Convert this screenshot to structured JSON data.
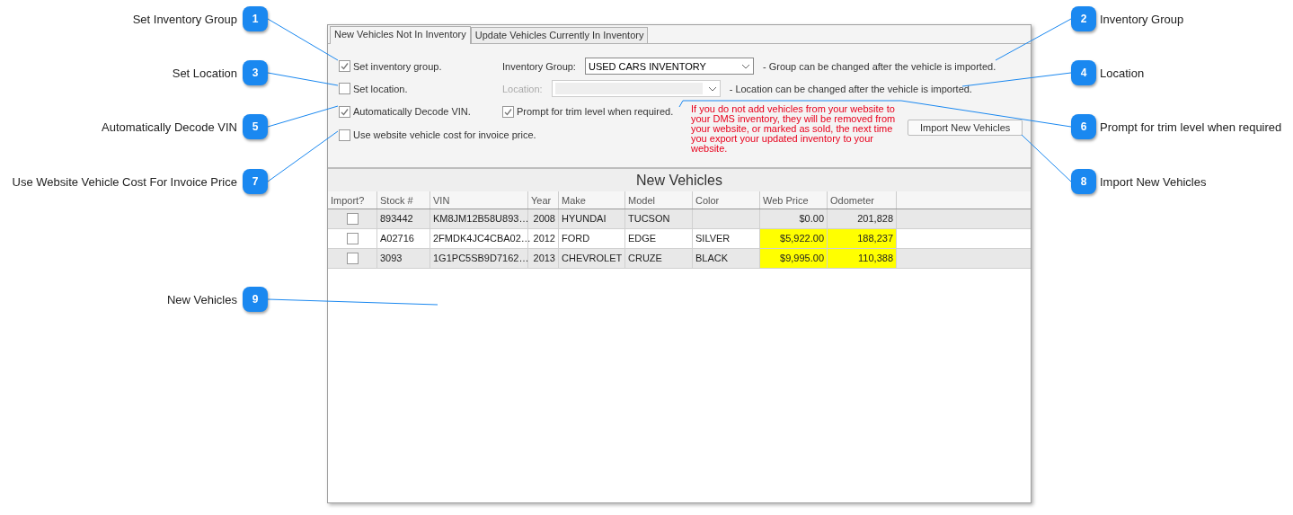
{
  "callouts": [
    {
      "number": "1",
      "label": "Set Inventory Group"
    },
    {
      "number": "2",
      "label": "Inventory Group"
    },
    {
      "number": "3",
      "label": "Set Location"
    },
    {
      "number": "4",
      "label": "Location"
    },
    {
      "number": "5",
      "label": "Automatically Decode VIN"
    },
    {
      "number": "6",
      "label": "Prompt for trim level when required"
    },
    {
      "number": "7",
      "label": "Use Website Vehicle Cost For Invoice Price"
    },
    {
      "number": "8",
      "label": "Import New Vehicles"
    },
    {
      "number": "9",
      "label": "New Vehicles"
    }
  ],
  "tabs": [
    {
      "label": "New Vehicles Not In Inventory",
      "selected": true
    },
    {
      "label": "Update Vehicles Currently In Inventory",
      "selected": false
    }
  ],
  "options": [
    {
      "label": "Set inventory group.",
      "checked": true
    },
    {
      "label": "Set location.",
      "checked": false
    },
    {
      "label": "Automatically Decode VIN.",
      "checked": true
    },
    {
      "label": "Use website vehicle cost for invoice price.",
      "checked": false
    }
  ],
  "group_field": {
    "label": "Inventory Group:",
    "value": "USED CARS INVENTORY",
    "disabled": false,
    "note": "- Group can be changed after the vehicle is imported."
  },
  "location_field": {
    "label": "Location:",
    "disabled": true,
    "note": "- Location can be changed after the vehicle is imported."
  },
  "trim_prompt": {
    "label": "Prompt for trim level when required.",
    "checked": true
  },
  "warning": "If you do not add vehicles from your website to your DMS inventory, they will be removed from your website, or marked as sold, the next time you export your updated inventory to your website.",
  "import_button": "Import New Vehicles",
  "grid": {
    "title": "New Vehicles",
    "import_header": "Import?",
    "columns": [
      "Stock #",
      "VIN",
      "Year",
      "Make",
      "Model",
      "Color",
      "Web Price",
      "Odometer"
    ],
    "rows": [
      {
        "import": false,
        "highlighted": false,
        "cells": [
          "893442",
          "KM8JM12B58U893…",
          "2008",
          "HYUNDAI",
          "TUCSON",
          "",
          "$0.00",
          "201,828"
        ]
      },
      {
        "import": false,
        "highlighted": true,
        "cells": [
          "A02716",
          "2FMDK4JC4CBA02…",
          "2012",
          "FORD",
          "EDGE",
          "SILVER",
          "$5,922.00",
          "188,237"
        ]
      },
      {
        "import": false,
        "highlighted": true,
        "cells": [
          "3093",
          "1G1PC5SB9D7162…",
          "2013",
          "CHEVROLET",
          "CRUZE",
          "BLACK",
          "$9,995.00",
          "110,388"
        ]
      }
    ]
  }
}
